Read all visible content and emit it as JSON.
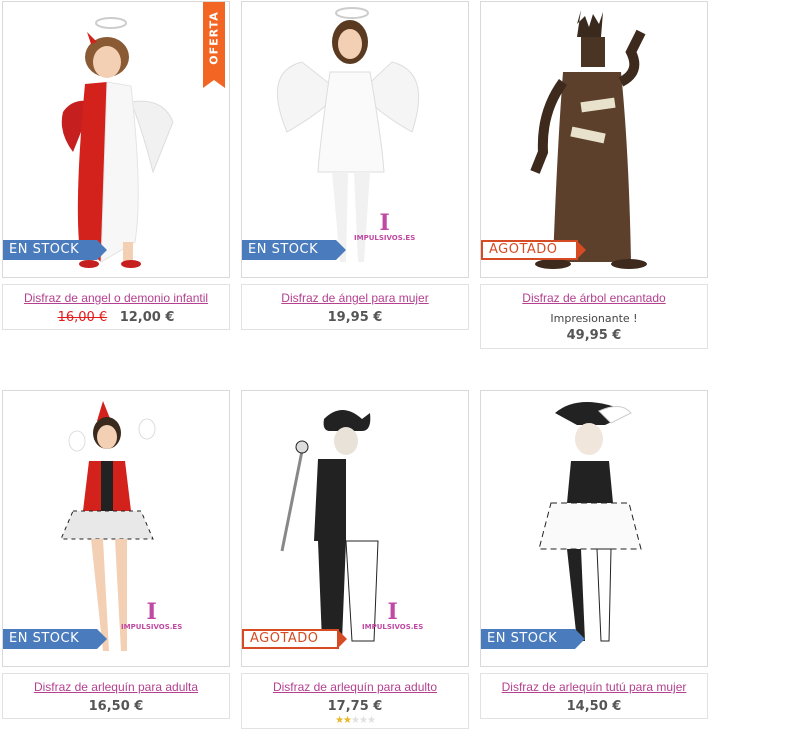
{
  "products": [
    {
      "name": "Disfraz de angel o demonio infantil",
      "old_price": "16,00 €",
      "price": "12,00 €",
      "badge": "EN STOCK",
      "badge_type": "stock",
      "ribbon": "OFERTA",
      "image": "angel-demon-child-costume"
    },
    {
      "name": "Disfraz de ángel para mujer",
      "price": "19,95 €",
      "badge": "EN STOCK",
      "badge_type": "stock",
      "watermark": "IMPULSIVOS.ES",
      "image": "angel-woman-costume"
    },
    {
      "name": "Disfraz de árbol encantado",
      "description": "Impresionante !",
      "price": "49,95 €",
      "badge": "AGOTADO",
      "badge_type": "out",
      "image": "enchanted-tree-costume"
    },
    {
      "name": "Disfraz de arlequín para adulta",
      "price": "16,50 €",
      "badge": "EN STOCK",
      "badge_type": "stock",
      "watermark": "IMPULSIVOS.ES",
      "image": "harlequin-woman-costume"
    },
    {
      "name": "Disfraz de arlequín para adulto",
      "price": "17,75 €",
      "badge": "AGOTADO",
      "badge_type": "out",
      "watermark": "IMPULSIVOS.ES",
      "rating": 2,
      "rating_max": 5,
      "image": "harlequin-man-costume"
    },
    {
      "name": "Disfraz de arlequín tutú para mujer",
      "price": "14,50 €",
      "badge": "EN STOCK",
      "badge_type": "stock",
      "image": "harlequin-tutu-costume"
    }
  ],
  "colors": {
    "link": "#b4418f",
    "old_price": "#e21b1b",
    "stock_badge": "#4a7cbd",
    "out_badge": "#d64b23",
    "ribbon": "#f26522",
    "star": "#e8b82a"
  }
}
